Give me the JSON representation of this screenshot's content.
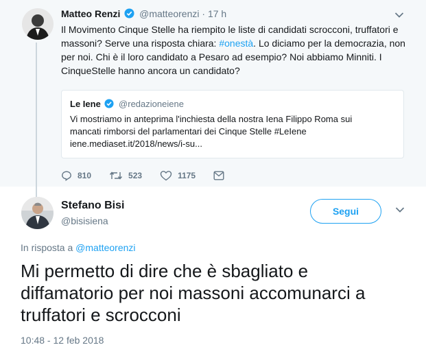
{
  "parent_tweet": {
    "author_name": "Matteo Renzi",
    "handle": "@matteorenzi",
    "separator": "·",
    "time": "17 h",
    "text_parts": [
      "Il Movimento Cinque Stelle ha riempito le liste di candidati scrocconi, truffatori e massoni? Serve una risposta chiara: ",
      "#onestà",
      ". Lo diciamo per la democrazia, non per noi. Chi è il loro candidato a Pesaro ad esempio? Noi abbiamo Minniti. I CinqueStelle hanno ancora un candidato?"
    ],
    "quoted": {
      "author_name": "Le Iene",
      "handle": "@redazioneiene",
      "text_line1": "Vi mostriamo in anteprima l'inchiesta della nostra Iena Filippo Roma sui",
      "text_line2": "mancati rimborsi del parlamentari dei Cinque Stelle #LeIene",
      "text_line3": "iene.mediaset.it/2018/news/i-su..."
    },
    "actions": {
      "replies": "810",
      "retweets": "523",
      "likes": "1175"
    }
  },
  "main_tweet": {
    "author_name": "Stefano Bisi",
    "handle": "@bisisiena",
    "follow_label": "Segui",
    "reply_prefix": "In risposta a ",
    "reply_handle": "@matteorenzi",
    "text": "Mi permetto di dire che è sbagliato e diffamatorio per noi massoni accomunarci a truffatori e scrocconi",
    "timestamp": "10:48 - 12 feb 2018"
  },
  "colors": {
    "accent": "#1da1f2",
    "muted": "#657786",
    "parent_bg": "#f5f8fa"
  },
  "icons": [
    "verified-icon",
    "chevron-down-icon",
    "reply-icon",
    "retweet-icon",
    "like-icon",
    "direct-message-icon"
  ]
}
